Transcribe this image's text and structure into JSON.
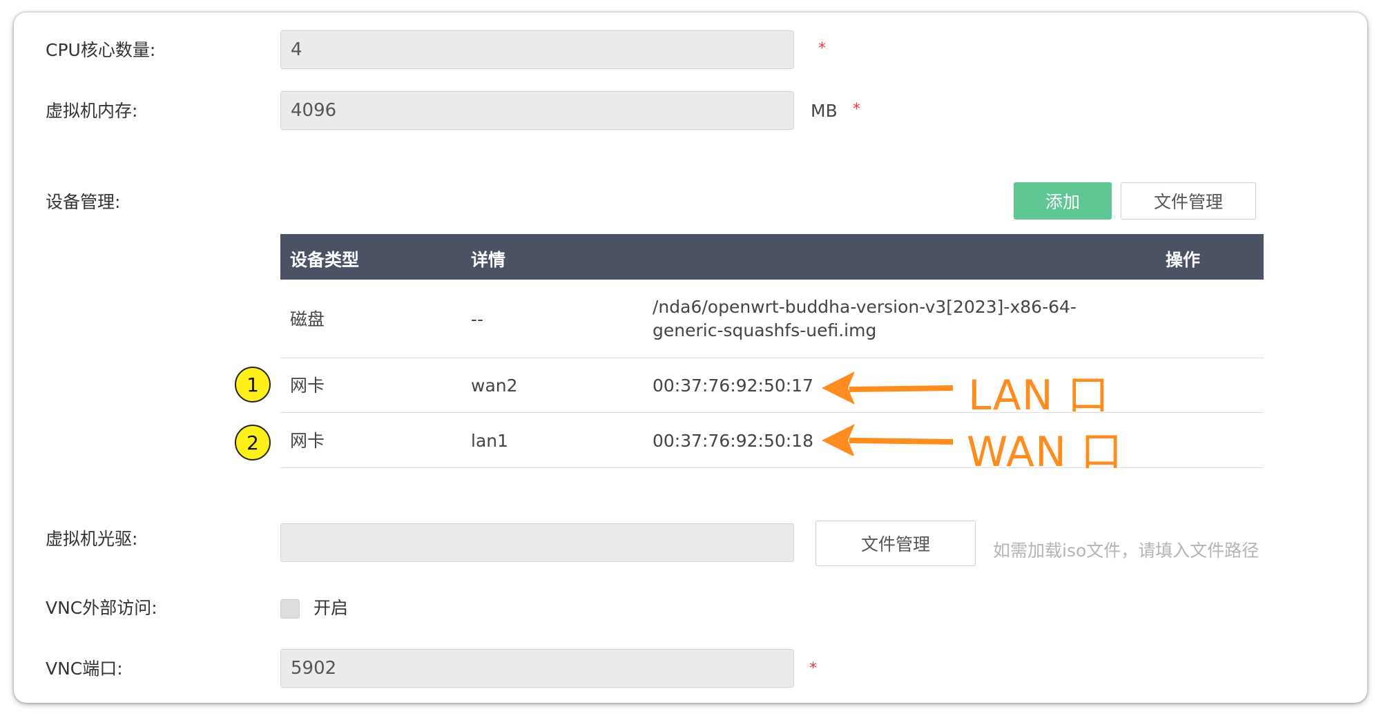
{
  "form": {
    "cpu_label": "CPU核心数量:",
    "cpu_value": "4",
    "mem_label": "虚拟机内存:",
    "mem_value": "4096",
    "mem_unit": "MB",
    "required_mark": "*",
    "device_label": "设备管理:",
    "add_button": "添加",
    "file_manage_button": "文件管理",
    "cdrom_label": "虚拟机光驱:",
    "cdrom_value": "",
    "cdrom_file_button": "文件管理",
    "cdrom_hint": "如需加载iso文件，请填入文件路径",
    "vnc_access_label": "VNC外部访问:",
    "vnc_access_option": "开启",
    "vnc_port_label": "VNC端口:",
    "vnc_port_value": "5902"
  },
  "table": {
    "headers": [
      "设备类型",
      "详情",
      "操作"
    ],
    "rows": [
      {
        "type": "磁盘",
        "name": "--",
        "detail_line1": "/nda6/openwrt-buddha-version-v3[2023]-x86-64-",
        "detail_line2": "generic-squashfs-uefi.img"
      },
      {
        "type": "网卡",
        "name": "wan2",
        "detail_line1": "00:37:76:92:50:17",
        "detail_line2": ""
      },
      {
        "type": "网卡",
        "name": "lan1",
        "detail_line1": "00:37:76:92:50:18",
        "detail_line2": ""
      }
    ]
  },
  "annotations": {
    "badge1": "1",
    "badge2": "2",
    "label1": "LAN 口",
    "label2": "WAN 口",
    "arrow_color": "#ff8c1f",
    "badge_color": "#ffef1a"
  },
  "colors": {
    "header_bg": "#4b5264",
    "add_button_bg": "#5fc794",
    "required": "#e63c3c"
  }
}
